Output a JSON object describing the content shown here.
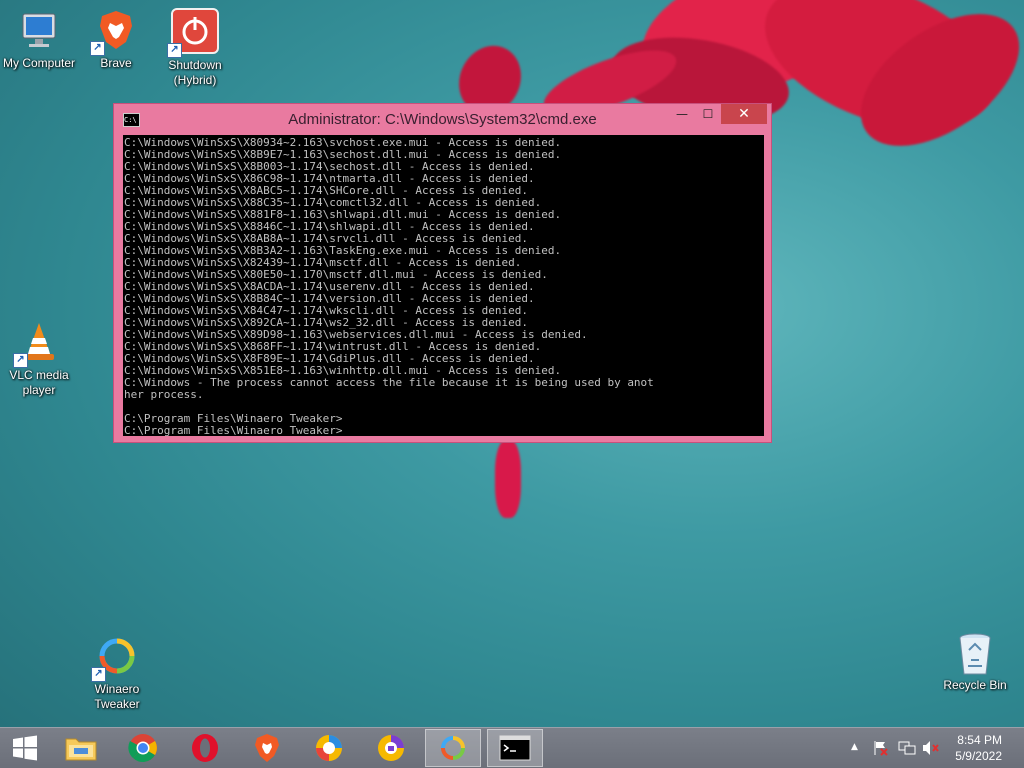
{
  "desktop": {
    "icons": [
      {
        "label_line1": "My Computer",
        "label_line2": ""
      },
      {
        "label_line1": "Brave",
        "label_line2": ""
      },
      {
        "label_line1": "Shutdown",
        "label_line2": "(Hybrid)"
      },
      {
        "label_line1": "VLC media",
        "label_line2": "player"
      },
      {
        "label_line1": "Winaero",
        "label_line2": "Tweaker"
      },
      {
        "label_line1": "Recycle Bin",
        "label_line2": ""
      }
    ]
  },
  "cmd_window": {
    "title": "Administrator: C:\\Windows\\System32\\cmd.exe",
    "icon_text": "C:\\",
    "minimize_label": "—",
    "maximize_label": "☐",
    "close_label": "✕",
    "output": "C:\\Windows\\WinSxS\\X80934~2.163\\svchost.exe.mui - Access is denied.\nC:\\Windows\\WinSxS\\X8B9E7~1.163\\sechost.dll.mui - Access is denied.\nC:\\Windows\\WinSxS\\X8B003~1.174\\sechost.dll - Access is denied.\nC:\\Windows\\WinSxS\\X86C98~1.174\\ntmarta.dll - Access is denied.\nC:\\Windows\\WinSxS\\X8ABC5~1.174\\SHCore.dll - Access is denied.\nC:\\Windows\\WinSxS\\X88C35~1.174\\comctl32.dll - Access is denied.\nC:\\Windows\\WinSxS\\X881F8~1.163\\shlwapi.dll.mui - Access is denied.\nC:\\Windows\\WinSxS\\X8846C~1.174\\shlwapi.dll - Access is denied.\nC:\\Windows\\WinSxS\\X8AB8A~1.174\\srvcli.dll - Access is denied.\nC:\\Windows\\WinSxS\\X8B3A2~1.163\\TaskEng.exe.mui - Access is denied.\nC:\\Windows\\WinSxS\\X82439~1.174\\msctf.dll - Access is denied.\nC:\\Windows\\WinSxS\\X80E50~1.170\\msctf.dll.mui - Access is denied.\nC:\\Windows\\WinSxS\\X8ACDA~1.174\\userenv.dll - Access is denied.\nC:\\Windows\\WinSxS\\X8B84C~1.174\\version.dll - Access is denied.\nC:\\Windows\\WinSxS\\X84C47~1.174\\wkscli.dll - Access is denied.\nC:\\Windows\\WinSxS\\X892CA~1.174\\ws2_32.dll - Access is denied.\nC:\\Windows\\WinSxS\\X89D98~1.163\\webservices.dll.mui - Access is denied.\nC:\\Windows\\WinSxS\\X868FF~1.174\\wintrust.dll - Access is denied.\nC:\\Windows\\WinSxS\\X8F89E~1.174\\GdiPlus.dll - Access is denied.\nC:\\Windows\\WinSxS\\X851E8~1.163\\winhttp.dll.mui - Access is denied.\nC:\\Windows - The process cannot access the file because it is being used by anot\nher process.\n\nC:\\Program Files\\Winaero Tweaker>\nC:\\Program Files\\Winaero Tweaker>"
  },
  "taskbar": {
    "items": [
      "Start",
      "File Explorer",
      "Google Chrome",
      "Opera",
      "Brave",
      "Browser",
      "Browser",
      "Winaero Tweaker",
      "Command Prompt"
    ],
    "clock_time": "8:54 PM",
    "clock_date": "5/9/2022",
    "tray_chevron": "▲"
  },
  "colors": {
    "window_frame": "#e97aa0",
    "close_button": "#c9454d",
    "console_bg": "#000000",
    "console_fg": "#c0c0c0",
    "taskbar": "#6f737d"
  }
}
